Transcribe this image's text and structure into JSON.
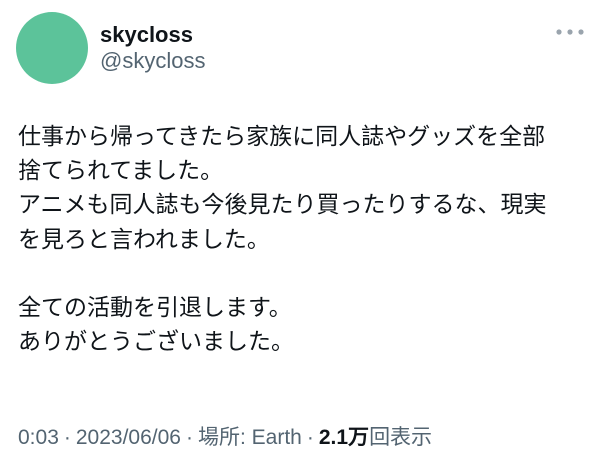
{
  "user": {
    "display_name": "skycloss",
    "handle": "@skycloss",
    "avatar_color": "#5cc39a"
  },
  "menu": {
    "icon": "more-horizontal-icon"
  },
  "tweet": {
    "lines": [
      "仕事から帰ってきたら家族に同人誌やグッズを全部",
      "捨てられてました。",
      "アニメも同人誌も今後見たり買ったりするな、現実",
      "を見ろと言われました。",
      "",
      "全ての活動を引退します。",
      "ありがとうございました。"
    ]
  },
  "meta": {
    "time": "0:03",
    "separator": "·",
    "date": "2023/06/06",
    "location_label": "場所: Earth",
    "views_count": "2.1万",
    "views_label": "回表示"
  },
  "colors": {
    "text_primary": "#0f1419",
    "text_secondary": "#536471",
    "icon": "#9aa4ad"
  }
}
